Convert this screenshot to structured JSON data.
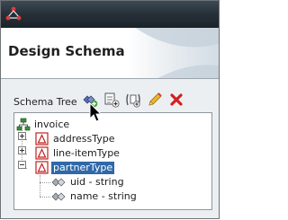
{
  "window": {
    "title": "Design Schema"
  },
  "toolbar": {
    "tree_label": "Schema Tree",
    "buttons": [
      {
        "name": "add-element-button",
        "icon": "add-element-icon"
      },
      {
        "name": "add-attribute-button",
        "icon": "add-attribute-icon"
      },
      {
        "name": "add-reference-button",
        "icon": "add-reference-icon"
      },
      {
        "name": "edit-button",
        "icon": "pencil-icon"
      },
      {
        "name": "delete-button",
        "icon": "red-x-icon"
      }
    ]
  },
  "tree": {
    "root": {
      "label": "invoice",
      "icon": "schema-icon",
      "expanded": true
    },
    "children": [
      {
        "label": "addressType",
        "icon": "type-icon",
        "expanded": false,
        "selected": false
      },
      {
        "label": "line-itemType",
        "icon": "type-icon",
        "expanded": false,
        "selected": false
      },
      {
        "label": "partnerType",
        "icon": "type-icon",
        "expanded": true,
        "selected": true,
        "children": [
          {
            "label": "uid - string",
            "icon": "attribute-icon"
          },
          {
            "label": "name - string",
            "icon": "attribute-icon"
          }
        ]
      }
    ]
  },
  "colors": {
    "selection": "#2f69a8",
    "titlebar": "#28323b",
    "delete": "#d32020",
    "accent_red": "#c0211f"
  }
}
